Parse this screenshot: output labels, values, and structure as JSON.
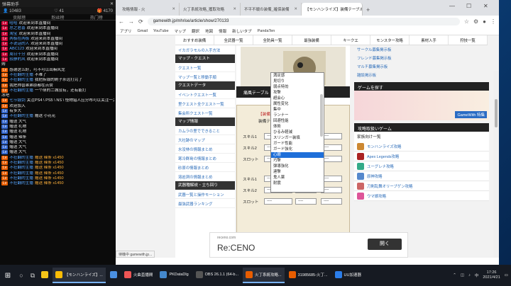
{
  "chat": {
    "title": "弹幕助手",
    "stats": {
      "viewers": "10483",
      "likes": "41",
      "gifts": "4170"
    },
    "tabs": [
      "贡献榜",
      "粉丝榜",
      "热门榜"
    ],
    "messages": [
      {
        "badge": "",
        "badge_color": "#c03",
        "user": "哈哈",
        "text": "欢迎来到本直播间"
      },
      {
        "badge": "",
        "badge_color": "#c03",
        "user": "总之君喜",
        "text": "欢迎来到本直播间"
      },
      {
        "badge": "",
        "badge_color": "#c03",
        "user": "淘宝",
        "text": "欢迎来到本直播间"
      },
      {
        "badge": "",
        "badge_color": "#c03",
        "user": "两极在两极",
        "text": "欢迎来到本直播间"
      },
      {
        "badge": "",
        "badge_color": "#c03",
        "user": "不说话的人",
        "text": "欢迎来到本直播间"
      },
      {
        "badge": "",
        "badge_color": "#c03",
        "user": "ABC123",
        "text": "欢迎来到本直播间"
      },
      {
        "badge": "",
        "badge_color": "#c03",
        "user": "周日十分",
        "text": "欢迎来到本直播间"
      },
      {
        "badge": "",
        "badge_color": "#c03",
        "user": "寂静的风",
        "text": "欢迎来到本直播间"
      },
      {
        "badge": "",
        "badge_color": "",
        "user": "",
        "text": "购"
      },
      {
        "badge": "",
        "badge_color": "#e85d00",
        "user": "",
        "text": "感谢这么好，可不可以出嘛风龙"
      },
      {
        "badge": "",
        "badge_color": "#e85d00",
        "user": "不狂翻的主播",
        "text": "不难了"
      },
      {
        "badge": "",
        "badge_color": "#e85d00",
        "user": "不狂翻的主播",
        "text": "我把拆锻的刷子永远打完了"
      },
      {
        "badge": "",
        "badge_color": "#e85d00",
        "user": "",
        "text": "我把帅兽弟弟原都在点赞"
      },
      {
        "badge": "",
        "badge_color": "#e85d00",
        "user": "不狂翻的主播",
        "text": "一个萌的二城没有，还有能打"
      },
      {
        "badge": "",
        "badge_color": "",
        "user": "",
        "text": "冰吧"
      },
      {
        "badge": "",
        "badge_color": "#e85d00",
        "user": "七节锻剑",
        "text": "关注PS4 \\ PS5 \\ NS \\ 怪物猎人应分布可以关注一关注吧~"
      },
      {
        "badge": "",
        "badge_color": "#e85d00",
        "user": "",
        "text": "欢迎加入"
      },
      {
        "badge": "",
        "badge_color": "#3366cc",
        "user": "",
        "text": "有多大"
      },
      {
        "badge": "",
        "badge_color": "#3366cc",
        "user": "不狂翻的主播",
        "text": "赠送 小花花"
      },
      {
        "badge": "",
        "badge_color": "#3366cc",
        "user": "",
        "text": "赠送 大气"
      },
      {
        "badge": "",
        "badge_color": "#3366cc",
        "user": "",
        "text": "赠送 礼物"
      },
      {
        "badge": "",
        "badge_color": "#3366cc",
        "user": "",
        "text": "赠送 礼物"
      },
      {
        "badge": "",
        "badge_color": "#3366cc",
        "user": "",
        "text": "赠送 辣条"
      },
      {
        "badge": "",
        "badge_color": "#3366cc",
        "user": "",
        "text": "赠送 大气"
      },
      {
        "badge": "",
        "badge_color": "#3366cc",
        "user": "",
        "text": "赠送 大气"
      },
      {
        "badge": "",
        "badge_color": "#3366cc",
        "user": "",
        "text": "赠送 大气"
      },
      {
        "badge": "",
        "badge_color": "#e85d00",
        "user": "不狂翻的主播",
        "text": "赠送 辣条 x1450"
      },
      {
        "badge": "",
        "badge_color": "#e85d00",
        "user": "不狂翻的主播",
        "text": "赠送 辣条 x1450"
      },
      {
        "badge": "",
        "badge_color": "#e85d00",
        "user": "不狂翻的主播",
        "text": "赠送 辣条 x1450"
      },
      {
        "badge": "",
        "badge_color": "#e85d00",
        "user": "不狂翻的主播",
        "text": "赠送 辣条 x1450"
      },
      {
        "badge": "",
        "badge_color": "#e85d00",
        "user": "不狂翻的主播",
        "text": "赠送 辣条 x1450"
      },
      {
        "badge": "",
        "badge_color": "#e85d00",
        "user": "不狂翻的主播",
        "text": "赠送 辣条 x1450"
      }
    ]
  },
  "browser": {
    "tabs": [
      {
        "title": "攻略情報 - 火",
        "active": false
      },
      {
        "title": "火丁系統攻略_獲取攻略",
        "active": false
      },
      {
        "title": "不平不戦の装備_確保装備",
        "active": false
      },
      {
        "title": "【モンハンライズ】装備テーブル",
        "active": true
      }
    ],
    "url": "gamewith.jp/mhrise/article/show/270133",
    "bookmarks": [
      "アプリ",
      "Gmail",
      "YouTube",
      "マップ",
      "翻訳",
      "地図",
      "情報",
      "新しいタブ",
      "PandaTen"
    ],
    "nav": [
      "おすすめ装備",
      "全武器一覧",
      "全防具一覧",
      "最強装備",
      "キークエ",
      "モンスター攻略",
      "素材入手",
      "狩技一覧"
    ],
    "left_menu": [
      {
        "type": "item",
        "text": "イカガラモルの入手方法"
      },
      {
        "type": "head",
        "text": "マップ・クエスト"
      },
      {
        "type": "item",
        "text": "クエスト一覧"
      },
      {
        "type": "item",
        "text": "マップ一覧と移動手順"
      },
      {
        "type": "head",
        "text": "クエストデータ"
      },
      {
        "type": "item",
        "text": "イベントクエスト一覧"
      },
      {
        "type": "item",
        "text": "里クエスト全クエスト一覧"
      },
      {
        "type": "item",
        "text": "集会所クエスト一覧"
      },
      {
        "type": "head",
        "text": "マップ情報"
      },
      {
        "type": "item",
        "text": "カムラの里でできること"
      },
      {
        "type": "item",
        "text": "大社跡のマップ"
      },
      {
        "type": "item",
        "text": "水没林の情報まとめ"
      },
      {
        "type": "item",
        "text": "寒冷群島の情報まとめ"
      },
      {
        "type": "item",
        "text": "砂原の情報まとめ"
      },
      {
        "type": "item",
        "text": "溶岩洞の情報まとめ"
      },
      {
        "type": "head",
        "text": "武器種解説・立ち回り"
      },
      {
        "type": "item",
        "text": "武器一覧と操作モーション"
      },
      {
        "type": "item",
        "text": "最強武器ランキング"
      }
    ],
    "center": {
      "banner": "痛風テーブル",
      "rows": [
        {
          "label": "スキル1",
          "value": "----"
        },
        {
          "label": "スキル2",
          "value": "----"
        },
        {
          "label": "スロット",
          "value": "----"
        },
        {
          "label": "スキル1",
          "value": "----"
        },
        {
          "label": "スキル2",
          "value": "----"
        },
        {
          "label": "スロット",
          "value": "----"
        }
      ],
      "box_text": [
        "【装備】",
        "装備テーブル"
      ]
    },
    "dropdown": {
      "items": [
        "満足感",
        "見切り",
        "弱点特効",
        "攻撃",
        "超会心",
        "属性変化",
        "集中",
        "ランナー",
        "回避性能",
        "体術",
        "ひるみ軽減",
        "スリンガー装填",
        "ガード性能",
        "ガード強化",
        "心眼",
        "巧撃",
        "弾導強化",
        "連撃",
        "鬼人薬",
        "耐震"
      ],
      "highlighted_index": 14
    },
    "right": {
      "links": [
        "サークル募集掲示板",
        "フレンド募集掲示板",
        "マルチ募集掲示板",
        "雑談掲示板"
      ],
      "promo_title": "ゲームを探す",
      "promo_text": "GameWith 特集",
      "game_head": "攻略取扱いゲーム",
      "game_head2": "家族向け一覧",
      "games": [
        {
          "name": "モンハンライズ攻略",
          "color": "#c83"
        },
        {
          "name": "Apex Legends攻略",
          "color": "#a22"
        },
        {
          "name": "ユーグレナ攻略",
          "color": "#3a8"
        },
        {
          "name": "原神攻略",
          "color": "#58c"
        },
        {
          "name": "刀剣乱舞オリーブゲン攻略",
          "color": "#c66"
        },
        {
          "name": "ウマ娘攻略",
          "color": "#d59"
        }
      ]
    },
    "ad": {
      "small": "receno.com",
      "brand": "Re:CENO",
      "button": "開く"
    },
    "status": "待機中 gamewith.jp..."
  },
  "taskbar": {
    "items": [
      {
        "label": "",
        "open": false,
        "color": "#f5c518"
      },
      {
        "label": "【モンハンライズ】...",
        "open": true,
        "color": "#fbbc05"
      },
      {
        "label": "",
        "open": false,
        "color": "#4a90e2"
      },
      {
        "label": "火曲直播間",
        "open": false,
        "color": "#e55"
      },
      {
        "label": "PKDataDlg",
        "open": false,
        "color": "#48c"
      },
      {
        "label": "OBS 26.1.1 (64-b...",
        "open": false,
        "color": "#555"
      },
      {
        "label": "火丁系統攻略...",
        "open": true,
        "color": "#e85d00"
      },
      {
        "label": "31985685-火丁...",
        "open": false,
        "color": "#e85d00"
      },
      {
        "label": "UU加速器",
        "open": false,
        "color": "#2b7de9"
      }
    ],
    "time": "17:26",
    "date": "2021/4/21",
    "lang": "中"
  }
}
